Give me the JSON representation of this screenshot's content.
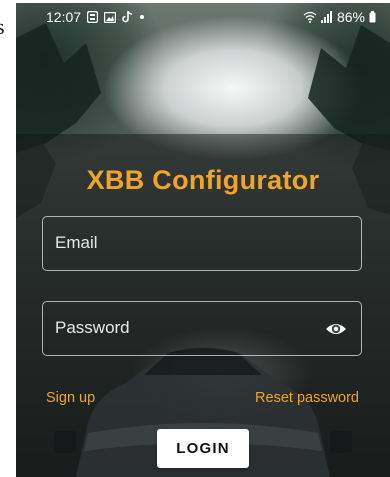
{
  "edge_fragment": "s",
  "status_bar": {
    "time": "12:07",
    "battery": "86%"
  },
  "app": {
    "title": "XBB Configurator"
  },
  "form": {
    "email_label": "Email",
    "password_label": "Password",
    "email_value": "",
    "password_value": "",
    "sign_up": "Sign up",
    "reset_password": "Reset password",
    "login": "LOGIN"
  },
  "colors": {
    "accent": "#f2a428",
    "button_bg": "#ffffff"
  },
  "icons": {
    "password_toggle": "eye-icon",
    "status_left": [
      "notification-icon",
      "gallery-icon",
      "tiktok-icon",
      "dot-icon"
    ],
    "status_right": [
      "wifi-icon",
      "signal-icon",
      "battery-icon"
    ]
  }
}
